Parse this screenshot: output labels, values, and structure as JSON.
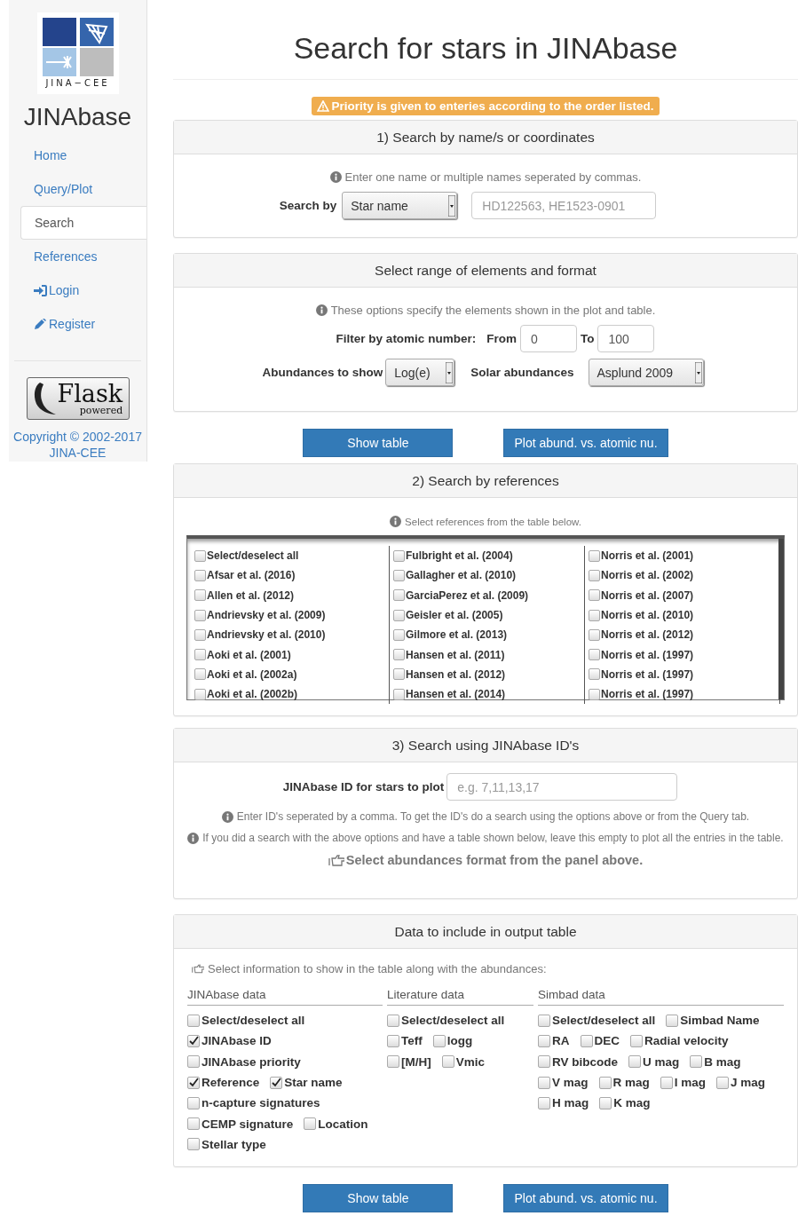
{
  "sidebar": {
    "logo_caption": "JINA−CEE",
    "site_title": "JINAbase",
    "nav": [
      {
        "label": "Home",
        "kind": "plain",
        "selected": false
      },
      {
        "label": "Query/Plot",
        "kind": "plain",
        "selected": false
      },
      {
        "label": "Search",
        "kind": "plain",
        "selected": true
      },
      {
        "label": "References",
        "kind": "plain",
        "selected": false
      },
      {
        "label": "Login",
        "kind": "login",
        "selected": false
      },
      {
        "label": "Register",
        "kind": "edit",
        "selected": false
      }
    ],
    "badge": {
      "title": "Flask",
      "subtitle": "powered"
    },
    "copyright": [
      "Copyright © 2002-2017",
      "JINA-CEE"
    ]
  },
  "page_title": "Search for stars in JINAbase",
  "warning": "Priority is given to enteries according to the order listed.",
  "name_panel": {
    "title": "1) Search by name/s or coordinates",
    "hint": "Enter one name or multiple names seperated by commas.",
    "search_by_label": "Search by",
    "search_by_value": "Star name",
    "names_placeholder": "HD122563, HE1523-0901"
  },
  "range_panel": {
    "title": "Select range of elements and format",
    "hint": "These options specify the elements shown in the plot and table.",
    "filter_label": "Filter by atomic number:",
    "from_label": "From",
    "from_value": "0",
    "to_label": "To",
    "to_value": "100",
    "abund_label": "Abundances to show",
    "abund_value": "Log(e)",
    "solar_label": "Solar abundances",
    "solar_value": "Asplund 2009"
  },
  "buttons_top": [
    "Show table",
    "Plot abund. vs. atomic nu."
  ],
  "ref_panel": {
    "title": "2) Search by references",
    "hint": "Select references from the table below.",
    "columns": [
      [
        {
          "label": "Select/deselect all",
          "checked": false
        },
        {
          "label": "Afsar et al. (2016)",
          "checked": false
        },
        {
          "label": "Allen et al. (2012)",
          "checked": false
        },
        {
          "label": "Andrievsky et al. (2009)",
          "checked": false
        },
        {
          "label": "Andrievsky et al. (2010)",
          "checked": false
        },
        {
          "label": "Aoki et al. (2001)",
          "checked": false
        },
        {
          "label": "Aoki et al. (2002a)",
          "checked": false
        },
        {
          "label": "Aoki et al. (2002b)",
          "checked": false
        }
      ],
      [
        {
          "label": "Fulbright et al. (2004)",
          "checked": false
        },
        {
          "label": "Gallagher et al. (2010)",
          "checked": false
        },
        {
          "label": "GarciaPerez et al. (2009)",
          "checked": false
        },
        {
          "label": "Geisler et al. (2005)",
          "checked": false
        },
        {
          "label": "Gilmore et al. (2013)",
          "checked": false
        },
        {
          "label": "Hansen et al. (2011)",
          "checked": false
        },
        {
          "label": "Hansen et al. (2012)",
          "checked": false
        },
        {
          "label": "Hansen et al. (2014)",
          "checked": false
        }
      ],
      [
        {
          "label": "Norris et al. (2001)",
          "checked": false
        },
        {
          "label": "Norris et al. (2002)",
          "checked": false
        },
        {
          "label": "Norris et al. (2007)",
          "checked": false
        },
        {
          "label": "Norris et al. (2010)",
          "checked": false
        },
        {
          "label": "Norris et al. (2012)",
          "checked": false
        },
        {
          "label": "Norris et al. (1997)",
          "checked": false
        },
        {
          "label": "Norris et al. (1997)",
          "checked": false
        },
        {
          "label": "Norris et al. (1997)",
          "checked": false
        }
      ]
    ]
  },
  "id_panel": {
    "title": "3) Search using JINAbase ID's",
    "id_label": "JINAbase ID for stars to plot",
    "id_placeholder": "e.g. 7,11,13,17",
    "hints": [
      "Enter ID's seperated by a comma. To get the ID's do a search using the options above or from the Query tab.",
      "If you did a search with the above options and have a table shown below, leave this empty to plot all the entries in the table."
    ],
    "pointer_note": "Select abundances format from the panel above."
  },
  "output_panel": {
    "title": "Data to include in output table",
    "intro": "Select information to show in the table along with the abundances:",
    "groups": [
      {
        "title": "JINAbase data",
        "lines": [
          {
            "options": [
              {
                "label": "Select/deselect all",
                "checked": false
              }
            ]
          },
          {
            "options": [
              {
                "label": "JINAbase ID",
                "checked": true
              }
            ]
          },
          {
            "options": [
              {
                "label": "JINAbase priority",
                "checked": false
              }
            ]
          },
          {
            "options": [
              {
                "label": "Reference",
                "checked": true
              },
              {
                "label": "Star name",
                "checked": true
              }
            ]
          },
          {
            "options": [
              {
                "label": "n-capture signatures",
                "checked": false
              }
            ]
          },
          {
            "options": [
              {
                "label": "CEMP signature",
                "checked": false
              },
              {
                "label": "Location",
                "checked": false
              }
            ]
          },
          {
            "options": [
              {
                "label": "Stellar type",
                "checked": false
              }
            ]
          }
        ]
      },
      {
        "title": "Literature data",
        "lines": [
          {
            "options": [
              {
                "label": "Select/deselect all",
                "checked": false
              }
            ]
          },
          {
            "options": [
              {
                "label": "Teff",
                "checked": false
              },
              {
                "label": "logg",
                "checked": false
              }
            ]
          },
          {
            "options": [
              {
                "label": "[M/H]",
                "checked": false
              },
              {
                "label": "Vmic",
                "checked": false
              }
            ]
          }
        ]
      },
      {
        "title": "Simbad data",
        "lines": [
          {
            "options": [
              {
                "label": "Select/deselect all",
                "checked": false
              },
              {
                "label": "Simbad Name",
                "checked": false
              }
            ]
          },
          {
            "options": [
              {
                "label": "RA",
                "checked": false
              },
              {
                "label": "DEC",
                "checked": false
              },
              {
                "label": "Radial velocity",
                "checked": false
              }
            ]
          },
          {
            "options": [
              {
                "label": "RV bibcode",
                "checked": false
              },
              {
                "label": "U mag",
                "checked": false
              },
              {
                "label": "B mag",
                "checked": false
              }
            ]
          },
          {
            "options": [
              {
                "label": "V mag",
                "checked": false
              },
              {
                "label": "R mag",
                "checked": false
              },
              {
                "label": "I mag",
                "checked": false
              },
              {
                "label": "J mag",
                "checked": false
              }
            ]
          },
          {
            "options": [
              {
                "label": "H mag",
                "checked": false
              },
              {
                "label": "K mag",
                "checked": false
              }
            ]
          }
        ]
      }
    ]
  },
  "buttons_bottom": [
    "Show table",
    "Plot abund. vs. atomic nu."
  ]
}
